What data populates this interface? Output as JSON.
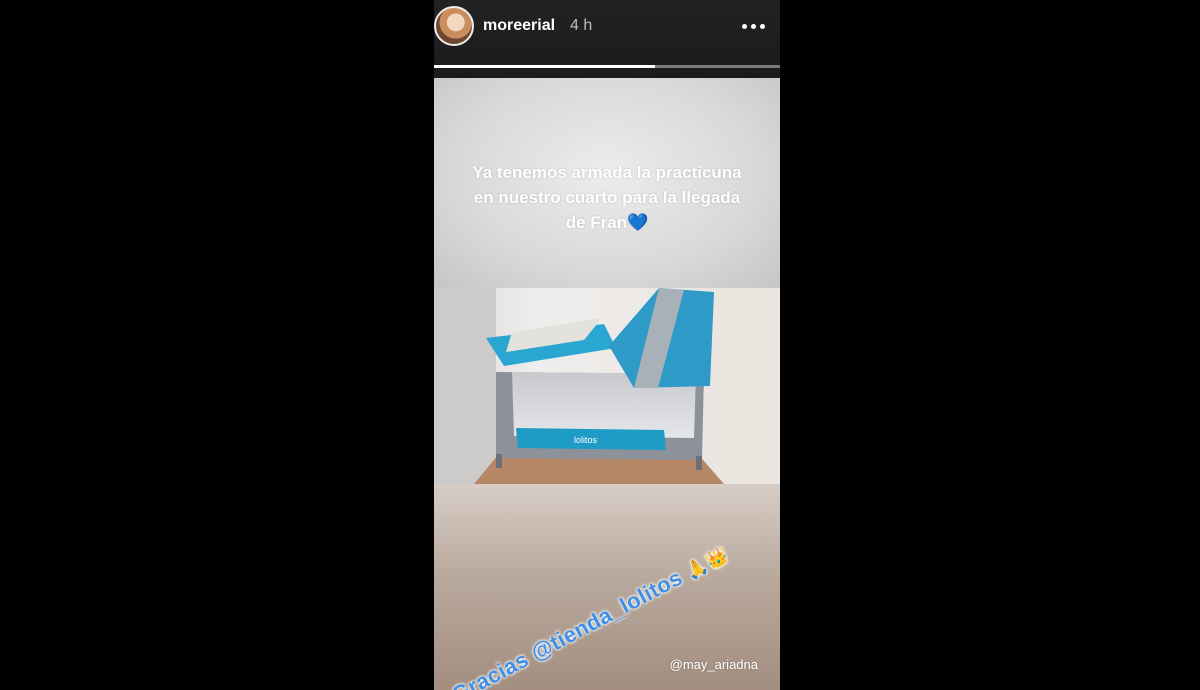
{
  "story": {
    "username": "moreerial",
    "time_ago": "4 h",
    "progress_fraction": 0.64,
    "more_icon": "more-horizontal-icon"
  },
  "caption": {
    "line1": "Ya tenemos armada la practicuna",
    "line2": "en nuestro cuarto para la llegada",
    "line3": "de Fran",
    "emoji": "💙"
  },
  "photo": {
    "brand_label": "lolitos"
  },
  "sticker": {
    "text": "Gracias @tienda_lolitos",
    "emoji_hands": "🙏",
    "emoji_crown": "👑"
  },
  "credit": "@may_ariadna",
  "colors": {
    "background": "#000000",
    "mention_blue": "#3f8fe6",
    "crib_blue": "#1f9cc6"
  }
}
